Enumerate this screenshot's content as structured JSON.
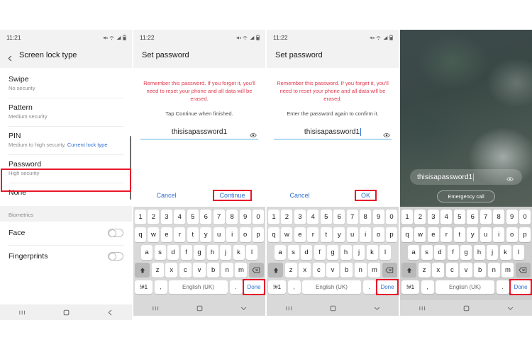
{
  "panels": [
    {
      "id": "screen-lock-type",
      "status": {
        "time": "11:21"
      },
      "appbar": {
        "title": "Screen lock type",
        "back_icon": "back-chevron-icon"
      },
      "list": [
        {
          "title": "Swipe",
          "sub": "No security",
          "link": ""
        },
        {
          "title": "Pattern",
          "sub": "Medium security",
          "link": ""
        },
        {
          "title": "PIN",
          "sub": "Medium to high security. ",
          "link": "Current lock type"
        },
        {
          "title": "Password",
          "sub": "High security",
          "link": "",
          "highlight": true
        },
        {
          "title": "None",
          "sub": "",
          "link": ""
        }
      ],
      "section_header": "Biometrics",
      "toggles": [
        {
          "label": "Face",
          "state": "off"
        },
        {
          "label": "Fingerprints",
          "state": "off"
        }
      ],
      "nav": {
        "recents": "recents-icon",
        "home": "home-icon",
        "back": "back-icon"
      }
    },
    {
      "id": "set-password-enter",
      "status": {
        "time": "11:22"
      },
      "appbar": {
        "title": "Set password"
      },
      "warning": "Remember this password. If you forget it, you'll need to reset your phone and all data will be erased.",
      "hint": "Tap Continue when finished.",
      "password_value": "thisisapassword1",
      "eye_icon": "eye-icon",
      "actions": {
        "cancel": "Cancel",
        "confirm": "Continue",
        "confirm_highlighted": true
      },
      "nav": {
        "recents": "recents-icon",
        "home": "home-icon",
        "back": "chevron-down-icon"
      }
    },
    {
      "id": "set-password-confirm",
      "status": {
        "time": "11:22"
      },
      "appbar": {
        "title": "Set password"
      },
      "warning": "Remember this password. If you forget it, you'll need to reset your phone and all data will be erased.",
      "hint": "Enter the password again to confirm it.",
      "password_value": "thisisapassword1",
      "eye_icon": "eye-icon",
      "actions": {
        "cancel": "Cancel",
        "confirm": "OK",
        "confirm_highlighted": true
      },
      "nav": {
        "recents": "recents-icon",
        "home": "home-icon",
        "back": "chevron-down-icon"
      }
    },
    {
      "id": "lock-screen",
      "password_value": "thisisapassword1",
      "eye_icon": "eye-icon",
      "emergency_label": "Emergency call",
      "nav": {
        "recents": "recents-icon",
        "home": "home-icon",
        "back": "chevron-down-icon"
      }
    }
  ],
  "keyboard": {
    "row_numbers": [
      "1",
      "2",
      "3",
      "4",
      "5",
      "6",
      "7",
      "8",
      "9",
      "0"
    ],
    "row_top": [
      "q",
      "w",
      "e",
      "r",
      "t",
      "y",
      "u",
      "i",
      "o",
      "p"
    ],
    "row_home": [
      "a",
      "s",
      "d",
      "f",
      "g",
      "h",
      "j",
      "k",
      "l"
    ],
    "row_bottom": [
      "z",
      "x",
      "c",
      "v",
      "b",
      "n",
      "m"
    ],
    "shift_icon": "shift-icon",
    "backspace_icon": "backspace-icon",
    "symbols_key": "!#1",
    "comma_key": ",",
    "space_key": "English (UK)",
    "period_key": ".",
    "done_key": "Done"
  },
  "colors": {
    "accent_blue": "#2f6fd0",
    "warning_red": "#e03a4e",
    "highlight_red": "#e8172a",
    "field_underline": "#5ab4e8",
    "appbar_bg": "#f2f2f2",
    "keyboard_bg": "#d9d9d9"
  }
}
